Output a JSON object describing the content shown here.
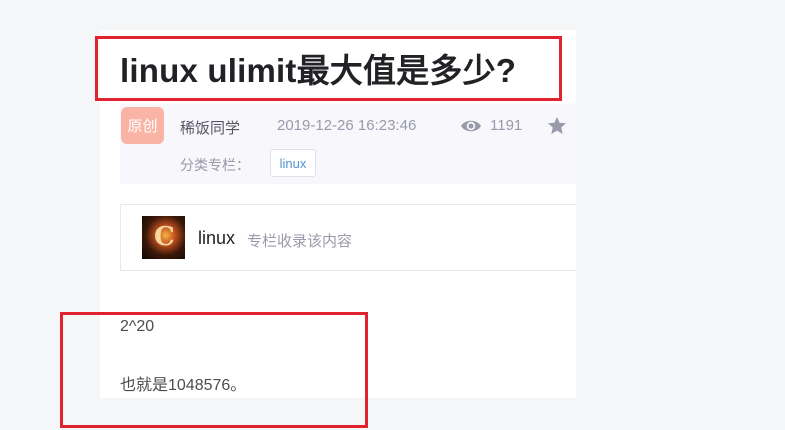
{
  "article": {
    "title": "linux ulimit最大值是多少?",
    "badge": "原创",
    "author": "稀饭同学",
    "date": "2019-12-26 16:23:46",
    "views": "1191",
    "category_label": "分类专栏：",
    "category_tag": "linux",
    "column": {
      "name": "linux",
      "description": "专栏收录该内容"
    },
    "paragraphs": [
      "2^20",
      "也就是1048576。"
    ]
  },
  "icons": {
    "views": "eye-icon",
    "favorite": "star-icon",
    "column_thumb": "column-thumbnail"
  },
  "colors": {
    "highlight_box": "#e0232e",
    "badge_bg": "#f9b4a5",
    "tag_text": "#5094d5"
  }
}
